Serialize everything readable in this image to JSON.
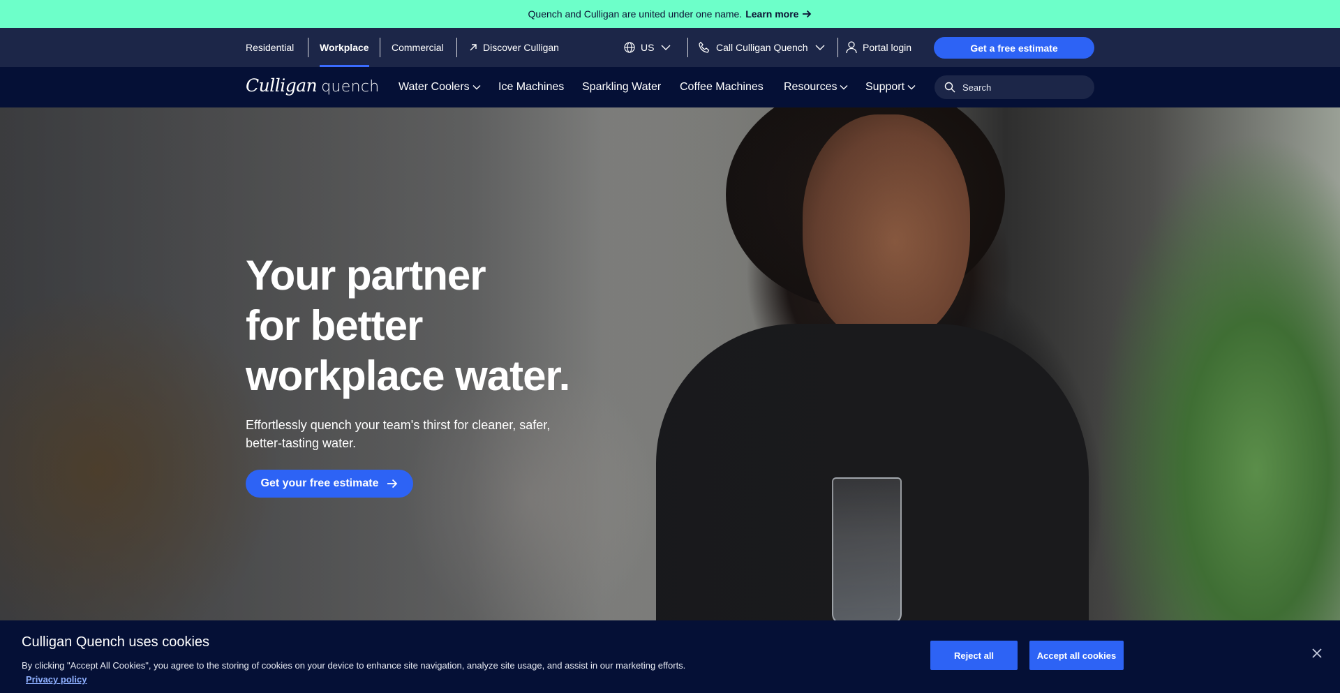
{
  "announcement": {
    "text": "Quench and Culligan are united under one name.",
    "link": "Learn more"
  },
  "utility": {
    "segments": [
      "Residential",
      "Workplace",
      "Commercial"
    ],
    "discover": "Discover Culligan",
    "region": "US",
    "call": "Call Culligan Quench",
    "portal": "Portal login",
    "estimate": "Get a free estimate"
  },
  "nav": {
    "logo_primary": "Culligan",
    "logo_secondary": "quench",
    "items": [
      "Water Coolers",
      "Ice Machines",
      "Sparkling Water",
      "Coffee Machines",
      "Resources",
      "Support"
    ],
    "search_placeholder": "Search"
  },
  "hero": {
    "title_lines": [
      "Your partner",
      "for better",
      "workplace water."
    ],
    "subtitle": "Effortlessly quench your team's thirst for cleaner, safer, better-tasting water.",
    "cta": "Get your free estimate"
  },
  "cookie": {
    "title": "Culligan Quench uses cookies",
    "text": "By clicking \"Accept All Cookies\", you agree to the storing of cookies on your device to enhance site navigation, analyze site usage, and assist in our marketing efforts.",
    "link": "Privacy policy",
    "reject": "Reject all",
    "accept": "Accept all cookies"
  },
  "colors": {
    "announcement_bg": "#6dffc9",
    "utility_bg": "#1c2648",
    "nav_bg": "#051036",
    "accent": "#2d63f5"
  },
  "icons": [
    "arrow-right-icon",
    "arrow-up-right-icon",
    "globe-icon",
    "chevron-down-icon",
    "phone-icon",
    "user-icon",
    "search-icon",
    "close-icon"
  ]
}
